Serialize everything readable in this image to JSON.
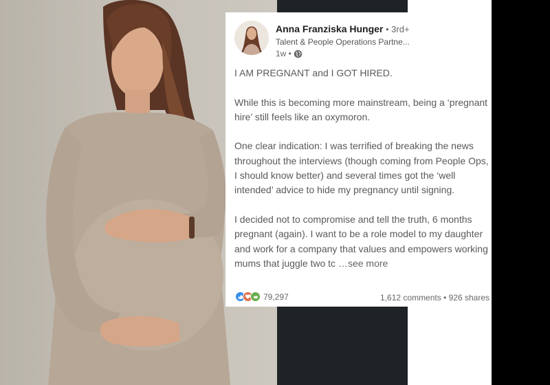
{
  "post": {
    "author_name": "Anna Franziska Hunger",
    "author_degree": " • 3rd+",
    "author_title": "Talent & People Operations Partne...",
    "time": "1w •",
    "paragraphs": [
      "I AM PREGNANT and I GOT HIRED.",
      "While this is becoming more mainstream, being a ‘pregnant hire’ still feels like an oxymoron.",
      "One clear indication: I was terrified of breaking the news throughout the interviews (though coming from People Ops, I should know better) and several times got the  ‘well intended’ advice to hide my pregnancy until signing.",
      "I decided not to compromise and tell the truth, 6 months pregnant (again). I want to be a role model to my daughter and work for a company that values and empowers working mums that juggle two tc"
    ],
    "see_more": " …see more",
    "reaction_count": "79,297",
    "comments": "1,612 comments",
    "shares": "926 shares",
    "stats_separator": " • "
  },
  "colors": {
    "like": "#378fe9",
    "love": "#df704d",
    "support": "#6dae4f",
    "dark_panel": "#1f2326"
  }
}
